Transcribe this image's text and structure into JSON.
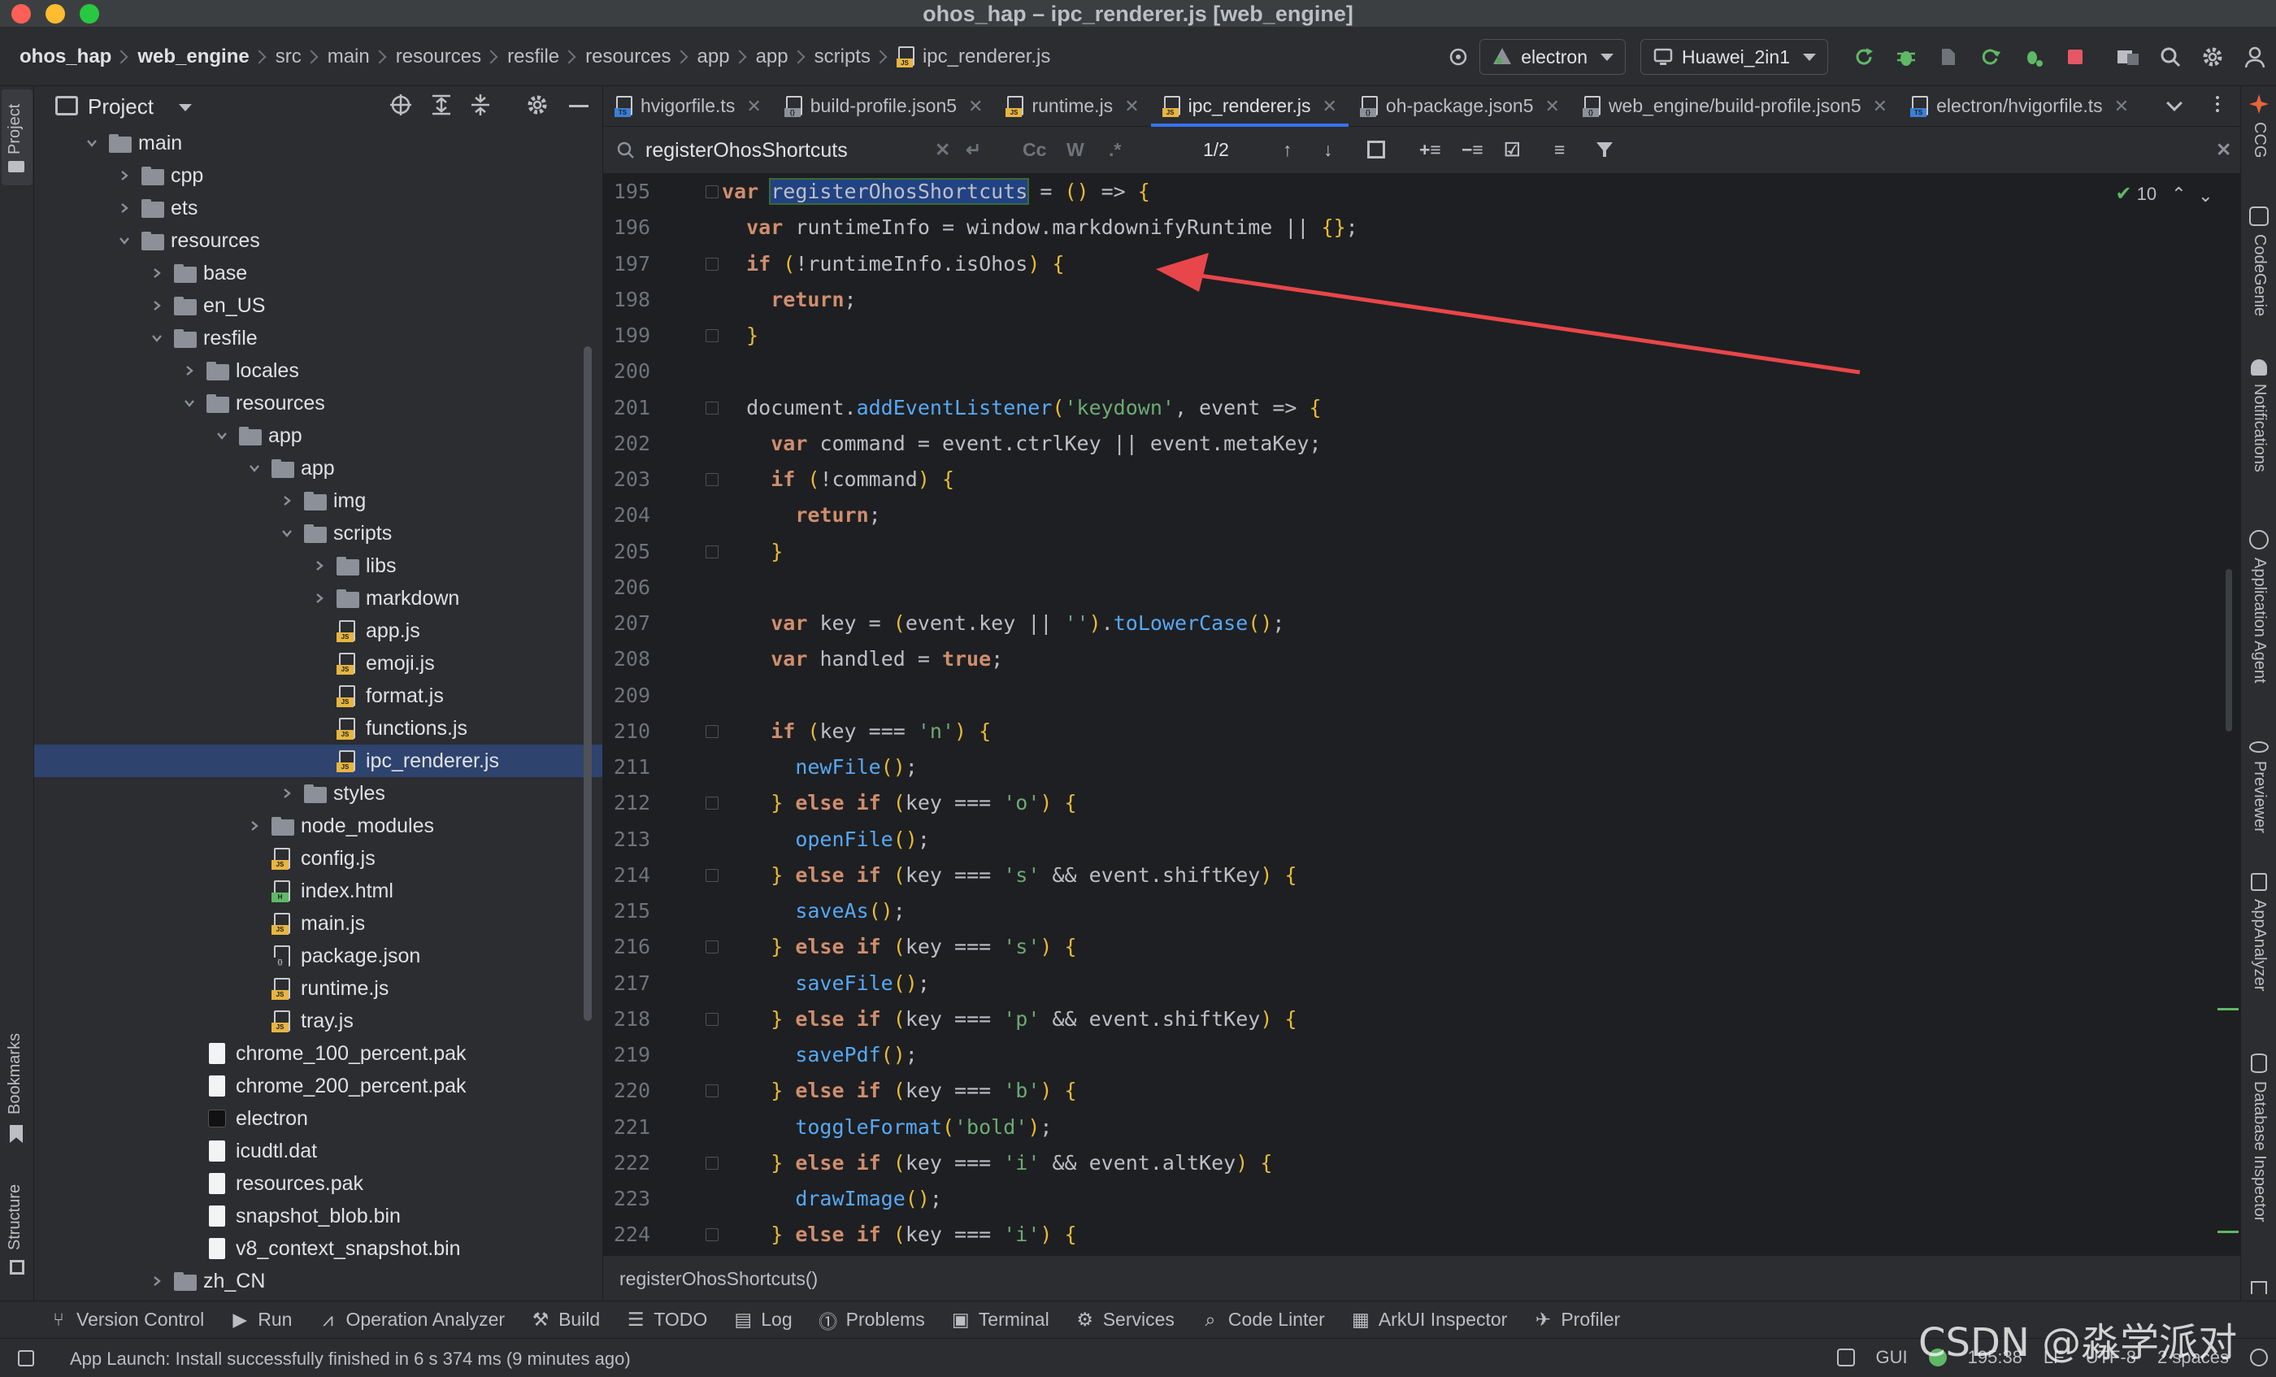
{
  "window": {
    "title": "ohos_hap – ipc_renderer.js [web_engine]"
  },
  "breadcrumbs": [
    {
      "label": "ohos_hap",
      "bold": true
    },
    {
      "label": "web_engine",
      "bold": true
    },
    {
      "label": "src"
    },
    {
      "label": "main"
    },
    {
      "label": "resources"
    },
    {
      "label": "resfile"
    },
    {
      "label": "resources"
    },
    {
      "label": "app"
    },
    {
      "label": "app"
    },
    {
      "label": "scripts"
    },
    {
      "label": "ipc_renderer.js",
      "file": true
    }
  ],
  "run_config": {
    "label": "electron"
  },
  "device": {
    "label": "Huawei_2in1"
  },
  "project_panel": {
    "title": "Project"
  },
  "tree": [
    {
      "label": "main",
      "type": "folder",
      "depth": 3,
      "open": true
    },
    {
      "label": "cpp",
      "type": "folder",
      "depth": 4
    },
    {
      "label": "ets",
      "type": "folder",
      "depth": 4
    },
    {
      "label": "resources",
      "type": "folder",
      "depth": 4,
      "open": true
    },
    {
      "label": "base",
      "type": "folder",
      "depth": 5
    },
    {
      "label": "en_US",
      "type": "folder",
      "depth": 5
    },
    {
      "label": "resfile",
      "type": "folder",
      "depth": 5,
      "open": true
    },
    {
      "label": "locales",
      "type": "folder",
      "depth": 6
    },
    {
      "label": "resources",
      "type": "folder",
      "depth": 6,
      "open": true
    },
    {
      "label": "app",
      "type": "folder",
      "depth": 7,
      "open": true
    },
    {
      "label": "app",
      "type": "folder",
      "depth": 8,
      "open": true
    },
    {
      "label": "img",
      "type": "folder",
      "depth": 9
    },
    {
      "label": "scripts",
      "type": "folder",
      "depth": 9,
      "open": true
    },
    {
      "label": "libs",
      "type": "folder",
      "depth": 10
    },
    {
      "label": "markdown",
      "type": "folder",
      "depth": 10
    },
    {
      "label": "app.js",
      "type": "js",
      "depth": 10,
      "leaf": true
    },
    {
      "label": "emoji.js",
      "type": "js",
      "depth": 10,
      "leaf": true
    },
    {
      "label": "format.js",
      "type": "js",
      "depth": 10,
      "leaf": true
    },
    {
      "label": "functions.js",
      "type": "js",
      "depth": 10,
      "leaf": true
    },
    {
      "label": "ipc_renderer.js",
      "type": "js",
      "depth": 10,
      "leaf": true,
      "selected": true
    },
    {
      "label": "styles",
      "type": "folder",
      "depth": 9
    },
    {
      "label": "node_modules",
      "type": "folder",
      "depth": 8
    },
    {
      "label": "config.js",
      "type": "js",
      "depth": 8,
      "leaf": true
    },
    {
      "label": "index.html",
      "type": "html",
      "depth": 8,
      "leaf": true
    },
    {
      "label": "main.js",
      "type": "js",
      "depth": 8,
      "leaf": true
    },
    {
      "label": "package.json",
      "type": "json",
      "depth": 8,
      "leaf": true
    },
    {
      "label": "runtime.js",
      "type": "js",
      "depth": 8,
      "leaf": true
    },
    {
      "label": "tray.js",
      "type": "js",
      "depth": 8,
      "leaf": true
    },
    {
      "label": "chrome_100_percent.pak",
      "type": "white",
      "depth": 6,
      "leaf": true
    },
    {
      "label": "chrome_200_percent.pak",
      "type": "white",
      "depth": 6,
      "leaf": true
    },
    {
      "label": "electron",
      "type": "black",
      "depth": 6,
      "leaf": true
    },
    {
      "label": "icudtl.dat",
      "type": "white",
      "depth": 6,
      "leaf": true
    },
    {
      "label": "resources.pak",
      "type": "white",
      "depth": 6,
      "leaf": true
    },
    {
      "label": "snapshot_blob.bin",
      "type": "white",
      "depth": 6,
      "leaf": true
    },
    {
      "label": "v8_context_snapshot.bin",
      "type": "white",
      "depth": 6,
      "leaf": true
    },
    {
      "label": "zh_CN",
      "type": "folder",
      "depth": 5
    }
  ],
  "tabs": [
    {
      "label": "hvigorfile.ts",
      "icon": "ts"
    },
    {
      "label": "build-profile.json5",
      "icon": "json"
    },
    {
      "label": "runtime.js",
      "icon": "js"
    },
    {
      "label": "ipc_renderer.js",
      "icon": "js",
      "active": true
    },
    {
      "label": "oh-package.json5",
      "icon": "json"
    },
    {
      "label": "web_engine/build-profile.json5",
      "icon": "json"
    },
    {
      "label": "electron/hvigorfile.ts",
      "icon": "ts"
    }
  ],
  "find": {
    "query": "registerOhosShortcuts",
    "match_case": "Cc",
    "words": "W",
    "regex": ".*",
    "count": "1/2"
  },
  "inspections": {
    "count": "10"
  },
  "code_lines": [
    {
      "n": "195",
      "tokens": [
        [
          "kw",
          "var "
        ],
        [
          "hl",
          "registerOhosShortcuts"
        ],
        [
          "pl",
          " = "
        ],
        [
          "br",
          "()"
        ],
        [
          "pl",
          " => "
        ],
        [
          "br",
          "{"
        ]
      ]
    },
    {
      "n": "196",
      "tokens": [
        [
          "pl",
          "  "
        ],
        [
          "kw",
          "var "
        ],
        [
          "pl",
          "runtimeInfo = window.markdownifyRuntime || "
        ],
        [
          "br",
          "{}"
        ],
        [
          "pl",
          ";"
        ]
      ]
    },
    {
      "n": "197",
      "tokens": [
        [
          "pl",
          "  "
        ],
        [
          "kw",
          "if "
        ],
        [
          "br",
          "("
        ],
        [
          "pl",
          "!runtimeInfo.isOhos"
        ],
        [
          "br",
          ")"
        ],
        [
          "pl",
          " "
        ],
        [
          "br",
          "{"
        ]
      ]
    },
    {
      "n": "198",
      "tokens": [
        [
          "pl",
          "    "
        ],
        [
          "kw",
          "return"
        ],
        [
          "pl",
          ";"
        ]
      ]
    },
    {
      "n": "199",
      "tokens": [
        [
          "pl",
          "  "
        ],
        [
          "br",
          "}"
        ]
      ]
    },
    {
      "n": "200",
      "tokens": []
    },
    {
      "n": "201",
      "tokens": [
        [
          "pl",
          "  document."
        ],
        [
          "fn",
          "addEventListener"
        ],
        [
          "br",
          "("
        ],
        [
          "str",
          "'keydown'"
        ],
        [
          "pl",
          ", event => "
        ],
        [
          "br",
          "{"
        ]
      ]
    },
    {
      "n": "202",
      "tokens": [
        [
          "pl",
          "    "
        ],
        [
          "kw",
          "var "
        ],
        [
          "pl",
          "command = event.ctrlKey || event.metaKey;"
        ]
      ]
    },
    {
      "n": "203",
      "tokens": [
        [
          "pl",
          "    "
        ],
        [
          "kw",
          "if "
        ],
        [
          "br",
          "("
        ],
        [
          "pl",
          "!command"
        ],
        [
          "br",
          ")"
        ],
        [
          "pl",
          " "
        ],
        [
          "br",
          "{"
        ]
      ]
    },
    {
      "n": "204",
      "tokens": [
        [
          "pl",
          "      "
        ],
        [
          "kw",
          "return"
        ],
        [
          "pl",
          ";"
        ]
      ]
    },
    {
      "n": "205",
      "tokens": [
        [
          "pl",
          "    "
        ],
        [
          "br",
          "}"
        ]
      ]
    },
    {
      "n": "206",
      "tokens": []
    },
    {
      "n": "207",
      "tokens": [
        [
          "pl",
          "    "
        ],
        [
          "kw",
          "var "
        ],
        [
          "pl",
          "key = "
        ],
        [
          "br",
          "("
        ],
        [
          "pl",
          "event.key || "
        ],
        [
          "str",
          "''"
        ],
        [
          "br",
          ")"
        ],
        [
          "pl",
          "."
        ],
        [
          "fn",
          "toLowerCase"
        ],
        [
          "br",
          "()"
        ],
        [
          "pl",
          ";"
        ]
      ]
    },
    {
      "n": "208",
      "tokens": [
        [
          "pl",
          "    "
        ],
        [
          "kw",
          "var "
        ],
        [
          "pl",
          "handled = "
        ],
        [
          "kw",
          "true"
        ],
        [
          "pl",
          ";"
        ]
      ]
    },
    {
      "n": "209",
      "tokens": []
    },
    {
      "n": "210",
      "tokens": [
        [
          "pl",
          "    "
        ],
        [
          "kw",
          "if "
        ],
        [
          "br",
          "("
        ],
        [
          "pl",
          "key === "
        ],
        [
          "str",
          "'n'"
        ],
        [
          "br",
          ")"
        ],
        [
          "pl",
          " "
        ],
        [
          "br",
          "{"
        ]
      ]
    },
    {
      "n": "211",
      "tokens": [
        [
          "pl",
          "      "
        ],
        [
          "fn",
          "newFile"
        ],
        [
          "br",
          "()"
        ],
        [
          "pl",
          ";"
        ]
      ]
    },
    {
      "n": "212",
      "tokens": [
        [
          "pl",
          "    "
        ],
        [
          "br",
          "}"
        ],
        [
          "kw",
          " else if "
        ],
        [
          "br",
          "("
        ],
        [
          "pl",
          "key === "
        ],
        [
          "str",
          "'o'"
        ],
        [
          "br",
          ")"
        ],
        [
          "pl",
          " "
        ],
        [
          "br",
          "{"
        ]
      ]
    },
    {
      "n": "213",
      "tokens": [
        [
          "pl",
          "      "
        ],
        [
          "fn",
          "openFile"
        ],
        [
          "br",
          "()"
        ],
        [
          "pl",
          ";"
        ]
      ]
    },
    {
      "n": "214",
      "tokens": [
        [
          "pl",
          "    "
        ],
        [
          "br",
          "}"
        ],
        [
          "kw",
          " else if "
        ],
        [
          "br",
          "("
        ],
        [
          "pl",
          "key === "
        ],
        [
          "str",
          "'s'"
        ],
        [
          "pl",
          " && event.shiftKey"
        ],
        [
          "br",
          ")"
        ],
        [
          "pl",
          " "
        ],
        [
          "br",
          "{"
        ]
      ]
    },
    {
      "n": "215",
      "tokens": [
        [
          "pl",
          "      "
        ],
        [
          "fn",
          "saveAs"
        ],
        [
          "br",
          "()"
        ],
        [
          "pl",
          ";"
        ]
      ]
    },
    {
      "n": "216",
      "tokens": [
        [
          "pl",
          "    "
        ],
        [
          "br",
          "}"
        ],
        [
          "kw",
          " else if "
        ],
        [
          "br",
          "("
        ],
        [
          "pl",
          "key === "
        ],
        [
          "str",
          "'s'"
        ],
        [
          "br",
          ")"
        ],
        [
          "pl",
          " "
        ],
        [
          "br",
          "{"
        ]
      ]
    },
    {
      "n": "217",
      "tokens": [
        [
          "pl",
          "      "
        ],
        [
          "fn",
          "saveFile"
        ],
        [
          "br",
          "()"
        ],
        [
          "pl",
          ";"
        ]
      ]
    },
    {
      "n": "218",
      "tokens": [
        [
          "pl",
          "    "
        ],
        [
          "br",
          "}"
        ],
        [
          "kw",
          " else if "
        ],
        [
          "br",
          "("
        ],
        [
          "pl",
          "key === "
        ],
        [
          "str",
          "'p'"
        ],
        [
          "pl",
          " && event.shiftKey"
        ],
        [
          "br",
          ")"
        ],
        [
          "pl",
          " "
        ],
        [
          "br",
          "{"
        ]
      ]
    },
    {
      "n": "219",
      "tokens": [
        [
          "pl",
          "      "
        ],
        [
          "fn",
          "savePdf"
        ],
        [
          "br",
          "()"
        ],
        [
          "pl",
          ";"
        ]
      ]
    },
    {
      "n": "220",
      "tokens": [
        [
          "pl",
          "    "
        ],
        [
          "br",
          "}"
        ],
        [
          "kw",
          " else if "
        ],
        [
          "br",
          "("
        ],
        [
          "pl",
          "key === "
        ],
        [
          "str",
          "'b'"
        ],
        [
          "br",
          ")"
        ],
        [
          "pl",
          " "
        ],
        [
          "br",
          "{"
        ]
      ]
    },
    {
      "n": "221",
      "tokens": [
        [
          "pl",
          "      "
        ],
        [
          "fn",
          "toggleFormat"
        ],
        [
          "br",
          "("
        ],
        [
          "str",
          "'bold'"
        ],
        [
          "br",
          ")"
        ],
        [
          "pl",
          ";"
        ]
      ]
    },
    {
      "n": "222",
      "tokens": [
        [
          "pl",
          "    "
        ],
        [
          "br",
          "}"
        ],
        [
          "kw",
          " else if "
        ],
        [
          "br",
          "("
        ],
        [
          "pl",
          "key === "
        ],
        [
          "str",
          "'i'"
        ],
        [
          "pl",
          " && event.altKey"
        ],
        [
          "br",
          ")"
        ],
        [
          "pl",
          " "
        ],
        [
          "br",
          "{"
        ]
      ]
    },
    {
      "n": "223",
      "tokens": [
        [
          "pl",
          "      "
        ],
        [
          "fn",
          "drawImage"
        ],
        [
          "br",
          "()"
        ],
        [
          "pl",
          ";"
        ]
      ]
    },
    {
      "n": "224",
      "tokens": [
        [
          "pl",
          "    "
        ],
        [
          "br",
          "}"
        ],
        [
          "kw",
          " else if "
        ],
        [
          "br",
          "("
        ],
        [
          "pl",
          "key === "
        ],
        [
          "str",
          "'i'"
        ],
        [
          "br",
          ")"
        ],
        [
          "pl",
          " "
        ],
        [
          "br",
          "{"
        ]
      ]
    }
  ],
  "editor_breadcrumb": "registerOhosShortcuts()",
  "right_tools": [
    "CCG",
    "CodeGenie",
    "Notifications",
    "Application Agent",
    "Previewer",
    "AppAnalyzer",
    "Database Inspector"
  ],
  "left_tools": [
    "Project",
    "Bookmarks",
    "Structure"
  ],
  "tool_windows": [
    {
      "label": "Version Control",
      "icon": "branch-icon"
    },
    {
      "label": "Run",
      "icon": "run-icon"
    },
    {
      "label": "Operation Analyzer",
      "icon": "chart-icon"
    },
    {
      "label": "Build",
      "icon": "hammer-icon"
    },
    {
      "label": "TODO",
      "icon": "list-icon"
    },
    {
      "label": "Log",
      "icon": "log-icon"
    },
    {
      "label": "Problems",
      "icon": "warning-icon"
    },
    {
      "label": "Terminal",
      "icon": "terminal-icon"
    },
    {
      "label": "Services",
      "icon": "services-icon"
    },
    {
      "label": "Code Linter",
      "icon": "linter-icon"
    },
    {
      "label": "ArkUI Inspector",
      "icon": "inspector-icon"
    },
    {
      "label": "Profiler",
      "icon": "profiler-icon"
    }
  ],
  "status": {
    "message": "App Launch: Install successfully finished in 6 s 374 ms (9 minutes ago)",
    "gui": "GUI",
    "position": "195:38",
    "line_sep": "LF",
    "encoding": "UTF-8",
    "indent": "2 spaces"
  },
  "watermark": "CSDN @淼学派对",
  "colors": {
    "accent": "#3574f0",
    "annotation_arrow": "#e8464a",
    "selection": "#2e436e"
  }
}
